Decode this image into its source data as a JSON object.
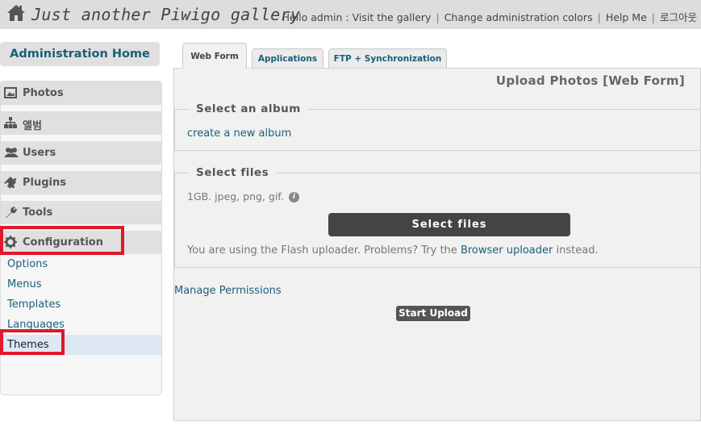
{
  "header": {
    "title": "Just another Piwigo gallery",
    "greeting": "Hello admin :",
    "links": {
      "visit": "Visit the gallery",
      "colors": "Change administration colors",
      "help": "Help Me",
      "logout": "로그아웃"
    }
  },
  "sidebar": {
    "admin_home": "Administration Home",
    "sections": {
      "photos": "Photos",
      "albums": "앨범",
      "users": "Users",
      "plugins": "Plugins",
      "tools": "Tools",
      "configuration": "Configuration"
    },
    "config_items": {
      "options": "Options",
      "menus": "Menus",
      "templates": "Templates",
      "languages": "Languages",
      "themes": "Themes"
    }
  },
  "tabs": {
    "web_form": "Web Form",
    "applications": "Applications",
    "ftp": "FTP + Synchronization"
  },
  "main": {
    "page_title": "Upload Photos [Web Form]",
    "album_legend": "Select an album",
    "create_album": "create a new album",
    "files_legend": "Select files",
    "file_limits": "1GB. jpeg, png, gif.",
    "select_files_button": "Select files",
    "flash_prefix": "You are using the Flash uploader. Problems? Try the",
    "browser_uploader": "Browser uploader",
    "flash_suffix": "instead.",
    "manage_permissions": "Manage Permissions",
    "start_upload": "Start Upload"
  },
  "colors": {
    "link": "#1a5f7a",
    "highlight_box": "#e0182b",
    "active_item_bg": "#dde8f3",
    "button_dark": "#444444"
  },
  "icons": [
    "home-icon",
    "photos-icon",
    "albums-icon",
    "users-icon",
    "plugins-icon",
    "tools-icon",
    "gear-icon",
    "info-icon"
  ]
}
